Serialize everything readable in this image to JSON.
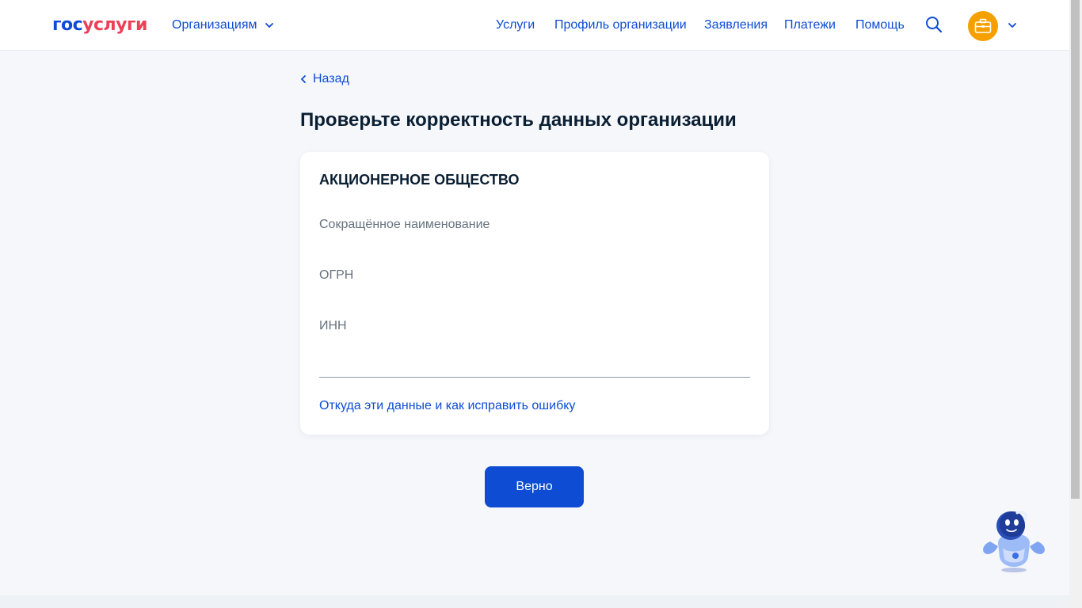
{
  "header": {
    "logo": {
      "part1": "гос",
      "part2": "услуги"
    },
    "org_switch_label": "Организациям",
    "nav": [
      {
        "label": "Услуги"
      },
      {
        "label": "Профиль организации"
      },
      {
        "label": "Заявления"
      },
      {
        "label": "Платежи"
      },
      {
        "label": "Помощь"
      }
    ],
    "search_icon": "search-icon",
    "avatar_icon": "briefcase-icon"
  },
  "main": {
    "back_label": "Назад",
    "title": "Проверьте корректность данных организации",
    "card": {
      "org_type": "АКЦИОНЕРНОЕ ОБЩЕСТВО",
      "fields": [
        {
          "label": "Сокращённое наименование",
          "value": ""
        },
        {
          "label": "ОГРН",
          "value": ""
        },
        {
          "label": "ИНН",
          "value": ""
        }
      ],
      "help_link": "Откуда эти данные и как исправить ошибку"
    },
    "confirm_button": "Верно"
  },
  "colors": {
    "brand_blue": "#0d4cd3",
    "brand_red": "#ee3f58",
    "avatar_orange": "#f6a000",
    "background": "#f5f7fb"
  }
}
